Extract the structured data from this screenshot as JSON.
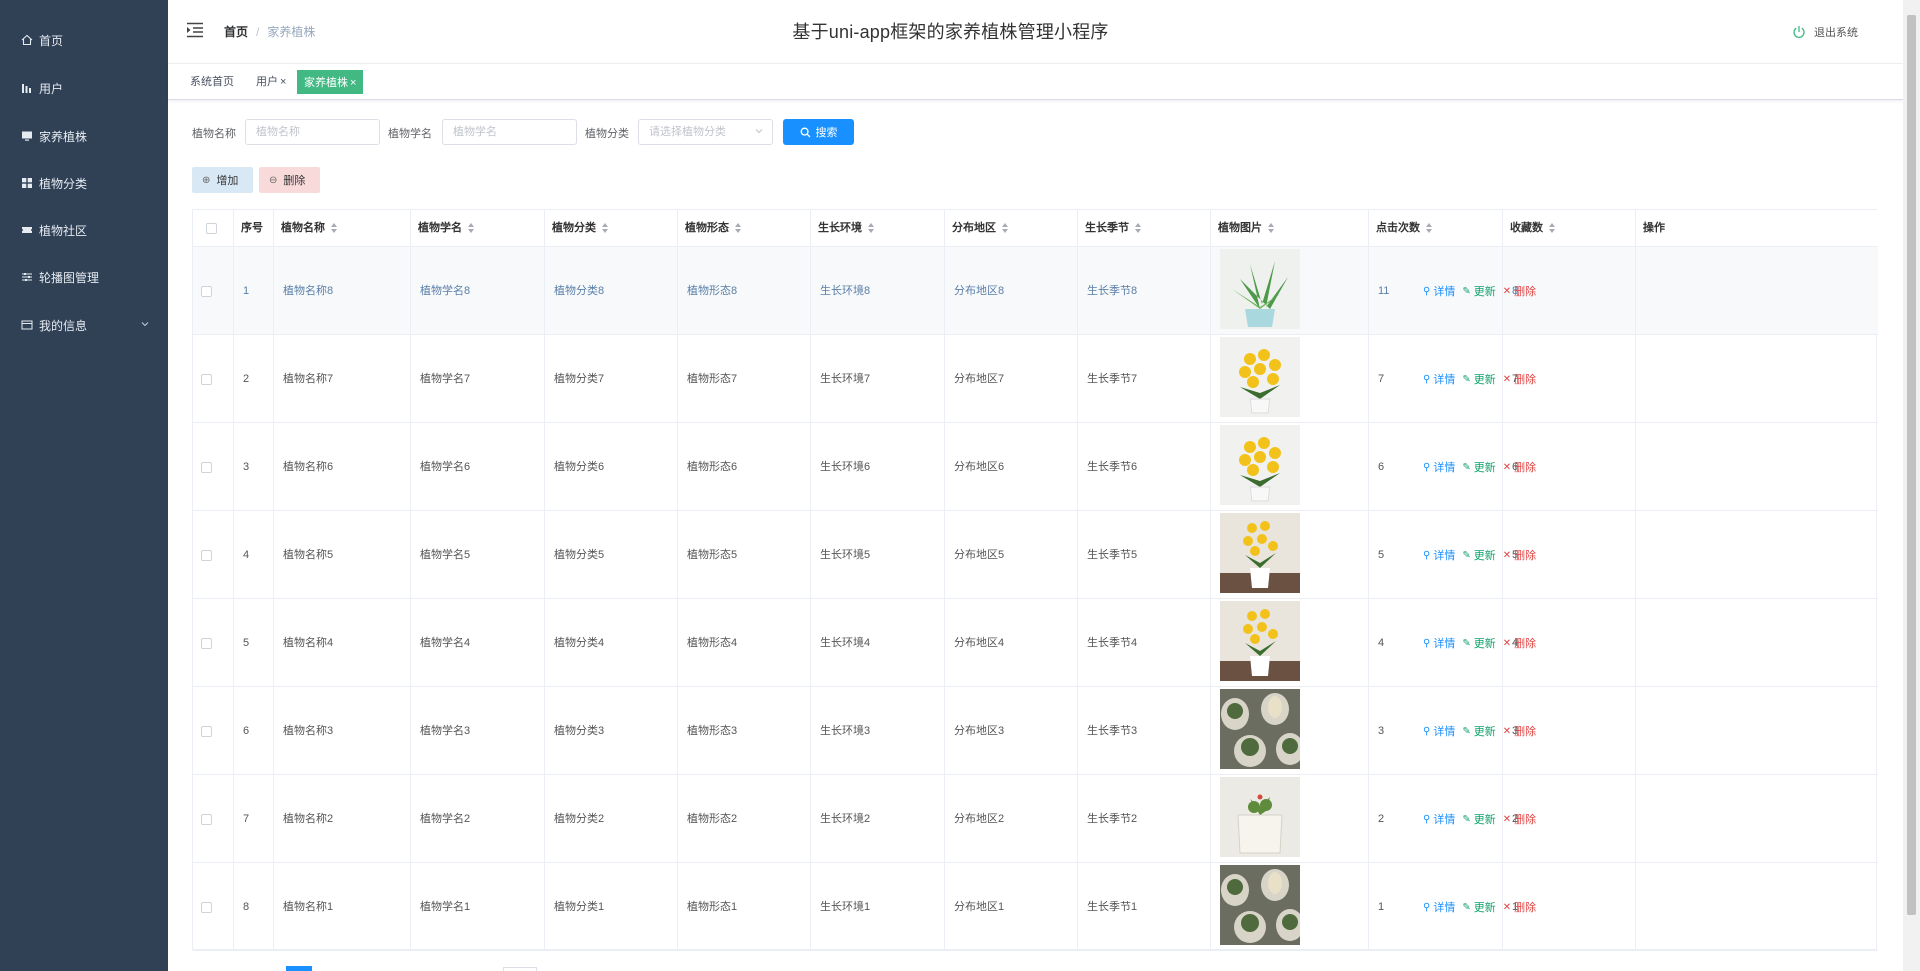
{
  "app": {
    "title": "基于uni-app框架的家养植株管理小程序",
    "logout_label": "退出系统"
  },
  "sidebar": {
    "items": [
      {
        "label": "首页",
        "icon": "home-icon"
      },
      {
        "label": "用户",
        "icon": "chart-bar-icon"
      },
      {
        "label": "家养植株",
        "icon": "monitor-icon"
      },
      {
        "label": "植物分类",
        "icon": "grid-icon"
      },
      {
        "label": "植物社区",
        "icon": "ticket-icon"
      },
      {
        "label": "轮播图管理",
        "icon": "sliders-icon"
      },
      {
        "label": "我的信息",
        "icon": "card-icon"
      }
    ]
  },
  "breadcrumb": {
    "home": "首页",
    "current": "家养植株"
  },
  "tags": [
    {
      "label": "系统首页"
    },
    {
      "label": "用户"
    },
    {
      "label": "家养植株"
    }
  ],
  "search": {
    "name_label": "植物名称",
    "name_placeholder": "植物名称",
    "sci_label": "植物学名",
    "sci_placeholder": "植物学名",
    "cat_label": "植物分类",
    "cat_placeholder": "请选择植物分类",
    "search_button": "搜索"
  },
  "actions": {
    "add": "增加",
    "delete": "删除"
  },
  "table": {
    "headers": [
      "序号",
      "植物名称",
      "植物学名",
      "植物分类",
      "植物形态",
      "生长环境",
      "分布地区",
      "生长季节",
      "植物图片",
      "点击次数",
      "收藏数",
      "操作"
    ],
    "op_labels": {
      "detail": "详情",
      "update": "更新",
      "delete": "删除"
    },
    "rows": [
      {
        "idx": "1",
        "name": "植物名称8",
        "sci": "植物学名8",
        "cat": "植物分类8",
        "form": "植物形态8",
        "env": "生长环境8",
        "region": "分布地区8",
        "season": "生长季节8",
        "img": "aloe",
        "clicks": "11",
        "favs": "8"
      },
      {
        "idx": "2",
        "name": "植物名称7",
        "sci": "植物学名7",
        "cat": "植物分类7",
        "form": "植物形态7",
        "env": "生长环境7",
        "region": "分布地区7",
        "season": "生长季节7",
        "img": "yellow",
        "clicks": "7",
        "favs": "7"
      },
      {
        "idx": "3",
        "name": "植物名称6",
        "sci": "植物学名6",
        "cat": "植物分类6",
        "form": "植物形态6",
        "env": "生长环境6",
        "region": "分布地区6",
        "season": "生长季节6",
        "img": "yellow",
        "clicks": "6",
        "favs": "6"
      },
      {
        "idx": "4",
        "name": "植物名称5",
        "sci": "植物学名5",
        "cat": "植物分类5",
        "form": "植物形态5",
        "env": "生长环境5",
        "region": "分布地区5",
        "season": "生长季节5",
        "img": "yellow-pot",
        "clicks": "5",
        "favs": "5"
      },
      {
        "idx": "5",
        "name": "植物名称4",
        "sci": "植物学名4",
        "cat": "植物分类4",
        "form": "植物形态4",
        "env": "生长环境4",
        "region": "分布地区4",
        "season": "生长季节4",
        "img": "yellow-pot",
        "clicks": "4",
        "favs": "4"
      },
      {
        "idx": "6",
        "name": "植物名称3",
        "sci": "植物学名3",
        "cat": "植物分类3",
        "form": "植物形态3",
        "env": "生长环境3",
        "region": "分布地区3",
        "season": "生长季节3",
        "img": "cactus",
        "clicks": "3",
        "favs": "3"
      },
      {
        "idx": "7",
        "name": "植物名称2",
        "sci": "植物学名2",
        "cat": "植物分类2",
        "form": "植物形态2",
        "env": "生长环境2",
        "region": "分布地区2",
        "season": "生长季节2",
        "img": "succulent",
        "clicks": "2",
        "favs": "2"
      },
      {
        "idx": "8",
        "name": "植物名称1",
        "sci": "植物学名1",
        "cat": "植物分类1",
        "form": "植物形态1",
        "env": "生长环境1",
        "region": "分布地区1",
        "season": "生长季节1",
        "img": "cactus",
        "clicks": "1",
        "favs": "1"
      }
    ]
  },
  "colors": {
    "sidebar_bg": "#304156",
    "primary": "#1890ff",
    "tag_active": "#42b983",
    "update": "#13a26b",
    "danger": "#e04343"
  }
}
